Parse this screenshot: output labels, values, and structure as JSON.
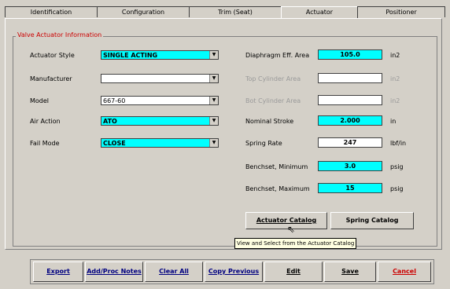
{
  "tabs": [
    "Identification",
    "Configuration",
    "Trim (Seat)",
    "Actuator",
    "Positioner"
  ],
  "group_title": "Valve Actuator Information",
  "left_fields": [
    {
      "label": "Actuator Style",
      "value": "SINGLE ACTING"
    },
    {
      "label": "Manufacturer",
      "value": ""
    },
    {
      "label": "Model",
      "value": "667-60"
    },
    {
      "label": "Air Action",
      "value": "ATO"
    },
    {
      "label": "Fail Mode",
      "value": "CLOSE"
    }
  ],
  "right_fields": [
    {
      "label": "Diaphragm Eff. Area",
      "value": "105.0",
      "unit": "in2"
    },
    {
      "label": "Top Cylinder Area",
      "value": "",
      "unit": "in2"
    },
    {
      "label": "Bot Cylinder Area",
      "value": "",
      "unit": "in2"
    },
    {
      "label": "Nominal Stroke",
      "value": "2.000",
      "unit": "in"
    },
    {
      "label": "Spring Rate",
      "value": "247",
      "unit": "lbf/in"
    },
    {
      "label": "Benchset, Minimum",
      "value": "3.0",
      "unit": "psig"
    },
    {
      "label": "Benchset, Maximum",
      "value": "15",
      "unit": "psig"
    }
  ],
  "catalog_buttons": {
    "actuator": "Actuator Catalog",
    "spring": "Spring Catalog"
  },
  "tooltip": "View and Select from the Actuator Catalog",
  "bottom_buttons": [
    "Export",
    "Add/Proc Notes",
    "Clear All",
    "Copy Previous",
    "Edit",
    "Save",
    "Cancel"
  ],
  "colors": {
    "highlight": "#00ffff",
    "cancel": "#cc0000",
    "title": "#cc0000"
  }
}
